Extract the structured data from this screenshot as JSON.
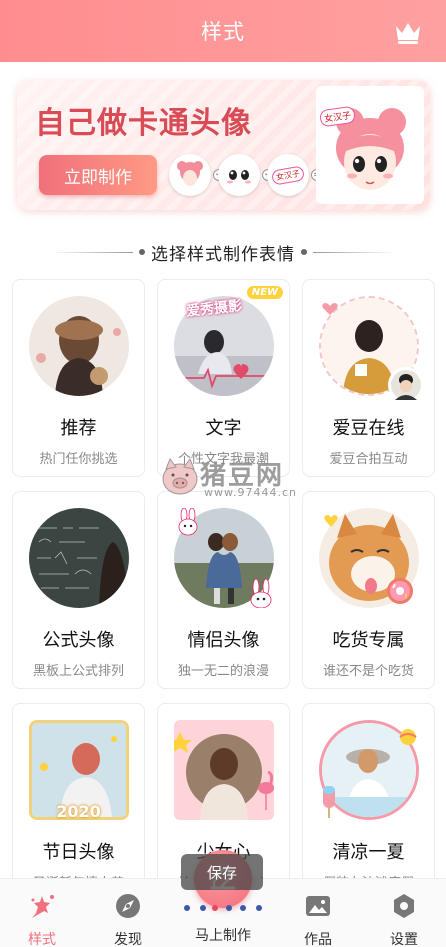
{
  "header": {
    "title": "样式",
    "crown_icon": "crown-icon"
  },
  "banner": {
    "title": "自己做卡通头像",
    "button_label": "立即制作",
    "tag_small": "女汉子",
    "tag_large": "女汉子",
    "ops": [
      "+",
      "+",
      "="
    ]
  },
  "section": {
    "title": "选择样式制作表情"
  },
  "cards": [
    {
      "title": "推荐",
      "subtitle": "热门任你挑选"
    },
    {
      "title": "文字",
      "subtitle": "个性文字我最潮",
      "badge": "NEW",
      "art_text": "爱秀摄影"
    },
    {
      "title": "爱豆在线",
      "subtitle": "爱豆合拍互动"
    },
    {
      "title": "公式头像",
      "subtitle": "黑板上公式排列"
    },
    {
      "title": "情侣头像",
      "subtitle": "独一无二的浪漫"
    },
    {
      "title": "吃货专属",
      "subtitle": "谁还不是个吃货"
    },
    {
      "title": "节日头像",
      "subtitle": "圣诞新年情人节",
      "art_text": "2020"
    },
    {
      "title": "少女心",
      "subtitle": "给你满满少女心"
    },
    {
      "title": "清凉一夏",
      "subtitle": "假装在沙滩度假"
    }
  ],
  "watermark": {
    "text": "猪豆网",
    "url": "www.97444.cn"
  },
  "save_tip": "保存",
  "nav": [
    {
      "label": "样式",
      "icon": "style-icon",
      "active": true
    },
    {
      "label": "发现",
      "icon": "discover-icon"
    },
    {
      "label": "马上制作",
      "icon": "create-icon"
    },
    {
      "label": "作品",
      "icon": "works-icon"
    },
    {
      "label": "设置",
      "icon": "settings-icon"
    }
  ],
  "colors": {
    "header": "#ff8d8f",
    "accent": "#f07080",
    "banner_text": "#d94b55"
  }
}
